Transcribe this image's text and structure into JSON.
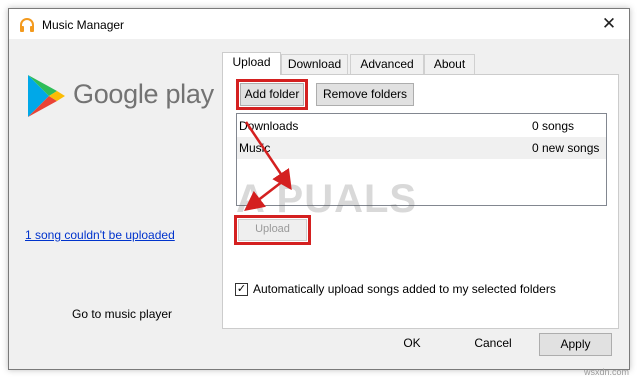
{
  "window": {
    "title": "Music Manager"
  },
  "left": {
    "brand": "Google play",
    "error_link": "1 song couldn't be uploaded",
    "go_to_player": "Go to music player"
  },
  "tabs": [
    {
      "label": "Upload",
      "active": true
    },
    {
      "label": "Download",
      "active": false
    },
    {
      "label": "Advanced",
      "active": false
    },
    {
      "label": "About",
      "active": false
    }
  ],
  "upload": {
    "add_folder": "Add folder",
    "remove_folders": "Remove folders",
    "folders": [
      {
        "name": "Downloads",
        "count": "0 songs"
      },
      {
        "name": "Music",
        "count": "0 new songs"
      }
    ],
    "upload_button": "Upload",
    "auto_upload_label": "Automatically upload songs added to my selected folders",
    "auto_upload_checked": true
  },
  "footer": {
    "ok": "OK",
    "cancel": "Cancel",
    "apply": "Apply"
  },
  "watermark": "A PUALS",
  "site_credit": "wsxdn.com",
  "colors": {
    "highlight": "#d42020",
    "link": "#0033cc"
  }
}
